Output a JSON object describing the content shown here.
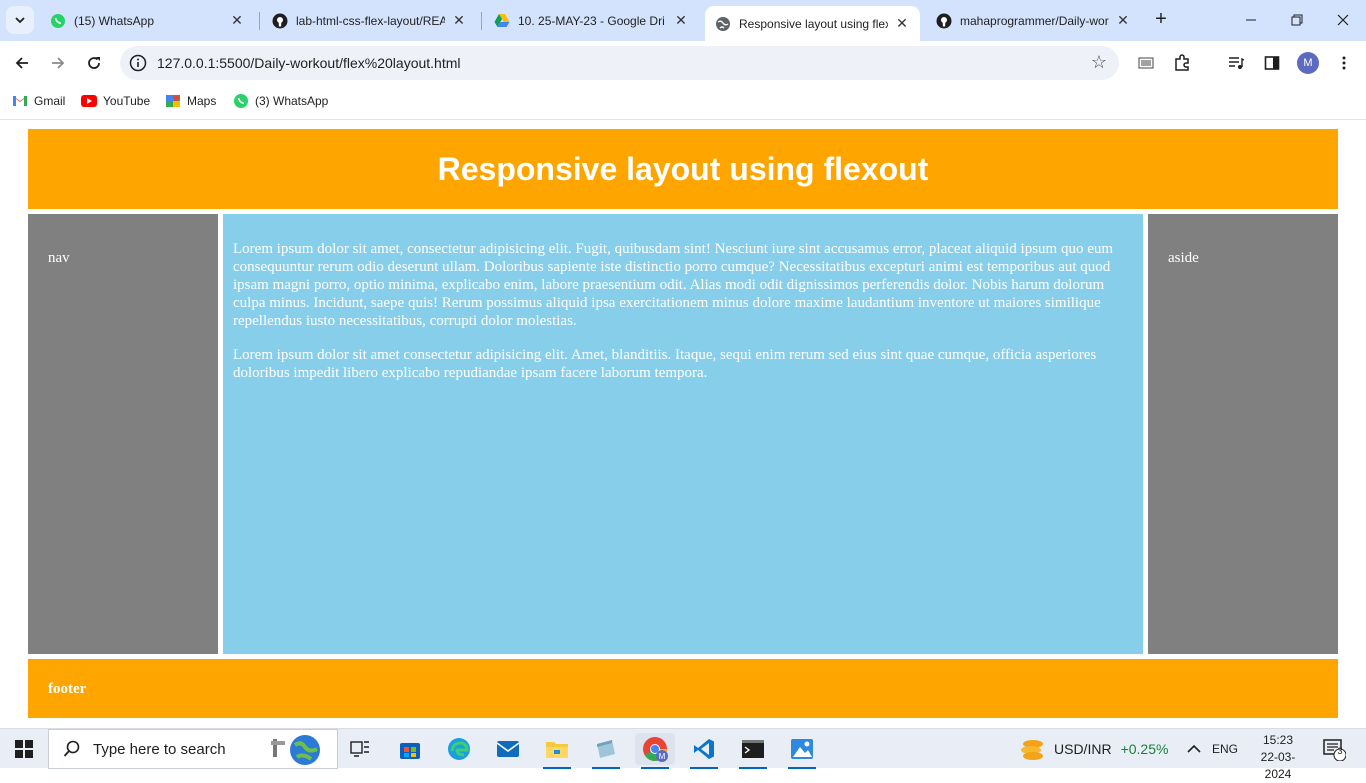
{
  "browser": {
    "tabs": [
      {
        "title": "(15) WhatsApp",
        "icon": "whatsapp-icon",
        "active": false
      },
      {
        "title": "lab-html-css-flex-layout/REA",
        "icon": "github-icon",
        "active": false
      },
      {
        "title": "10. 25-MAY-23 - Google Dri",
        "icon": "google-drive-icon",
        "active": false
      },
      {
        "title": "Responsive layout using flex",
        "icon": "globe-icon",
        "active": true
      },
      {
        "title": "mahaprogrammer/Daily-wor",
        "icon": "github-icon",
        "active": false
      }
    ],
    "new_tab_label": "+",
    "url": "127.0.0.1:5500/Daily-workout/flex%20layout.html",
    "profile_initial": "M",
    "bookmarks": [
      {
        "label": "Gmail",
        "icon": "gmail-icon"
      },
      {
        "label": "YouTube",
        "icon": "youtube-icon"
      },
      {
        "label": "Maps",
        "icon": "maps-icon"
      },
      {
        "label": "(3) WhatsApp",
        "icon": "whatsapp-icon"
      }
    ]
  },
  "page": {
    "header_title": "Responsive layout using flexout",
    "nav_text": "nav",
    "main_paragraphs": [
      "Lorem ipsum dolor sit amet, consectetur adipisicing elit. Fugit, quibusdam sint! Nesciunt iure sint accusamus error, placeat aliquid ipsum quo eum consequuntur rerum odio deserunt ullam. Doloribus sapiente iste distinctio porro cumque? Necessitatibus excepturi animi est temporibus aut quod ipsam magni porro, optio minima, explicabo enim, labore praesentium odit. Alias modi odit dignissimos perferendis dolor. Nobis harum dolorum culpa minus. Incidunt, saepe quis! Rerum possimus aliquid ipsa exercitationem minus dolore maxime laudantium inventore ut maiores similique repellendus iusto necessitatibus, corrupti dolor molestias.",
      "Lorem ipsum dolor sit amet consectetur adipisicing elit. Amet, blanditiis. Itaque, sequi enim rerum sed eius sint quae cumque, officia asperiores doloribus impedit libero explicabo repudiandae ipsam facere laborum tempora."
    ],
    "aside_text": "aside",
    "footer_text": "footer",
    "colors": {
      "header": "#ffa500",
      "sidebar": "#808080",
      "main": "#87ceeb"
    }
  },
  "taskbar": {
    "search_placeholder": "Type here to search",
    "currency_label": "USD/INR",
    "currency_change": "+0.25%",
    "language": "ENG",
    "time": "15:23",
    "date": "22-03-2024",
    "notification_count": "3"
  }
}
